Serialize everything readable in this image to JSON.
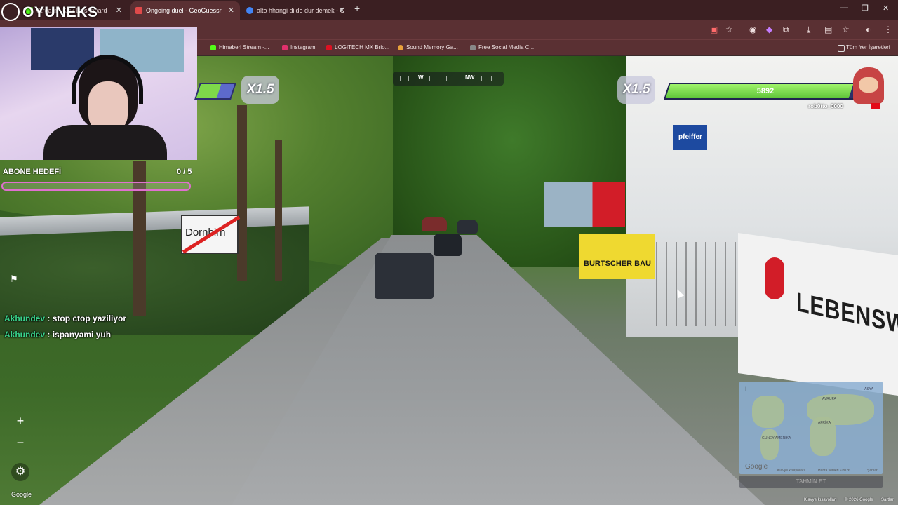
{
  "browser": {
    "tabs": [
      {
        "label": "Stream - Kick Dashboard",
        "favicon_color": "#53fc18"
      },
      {
        "label": "Ongoing duel - GeoGuessr",
        "favicon_color": "#e04a4a"
      },
      {
        "label": "alto hhangi dilde dur demek - G",
        "favicon_color": "#4285f4"
      }
    ],
    "new_tab": "+",
    "window_controls": [
      "—",
      "❐",
      "✕"
    ],
    "bookmarks": [
      {
        "label": "Himaberl Stream -...",
        "color": "#53fc18"
      },
      {
        "label": "Instagram",
        "color": "#e1306c"
      },
      {
        "label": "LOGITECH MX Brio...",
        "color": "#d12"
      },
      {
        "label": "Sound Memory Ga...",
        "color": "#e9a23b"
      },
      {
        "label": "Free Social Media C...",
        "color": "#888"
      }
    ],
    "all_bookmarks": "Tüm Yer İşaretleri"
  },
  "overlay": {
    "logo": "OYUNEKS",
    "sub_goal": {
      "title": "ABONE HEDEFİ",
      "count": "0 / 5",
      "progress": 0.0
    },
    "chat": [
      {
        "user": "Akhundev",
        "message": ": stop ctop yaziliyor"
      },
      {
        "user": "Akhundev",
        "message": ": ispanyami yuh"
      }
    ]
  },
  "game": {
    "compass": {
      "w": "W",
      "nw": "NW"
    },
    "left_multiplier": "X1.5",
    "right_multiplier": "X1.5",
    "opponent_hp": "5892",
    "opponent_hp_fraction": 0.94,
    "left_hp_fraction": 0.6,
    "opponent_name": "rob0tto_0000",
    "zoom_in": "+",
    "zoom_out": "−",
    "settings_icon": "⚙",
    "google": "Google",
    "minimap": {
      "labels": [
        "AVRUPA",
        "ASYA",
        "AFRİKA",
        "GÜNEY AMERİKA"
      ],
      "google": "Google",
      "attr1": "Klavye kısayolları",
      "attr2": "Harita verileri ©2026",
      "attr3": "Şartlar",
      "guess_button": "TAHMİN ET"
    },
    "attribution": {
      "shortcuts": "Klavye kısayolları",
      "copyright": "© 2026 Google",
      "terms": "Şartlar"
    }
  },
  "scene_signs": {
    "city_sign": "Dornbirn",
    "burtscher": "BURTSCHER BAU",
    "lebenswelt": "LEBENSWELT",
    "pfeiffer": "pfeiffer"
  }
}
